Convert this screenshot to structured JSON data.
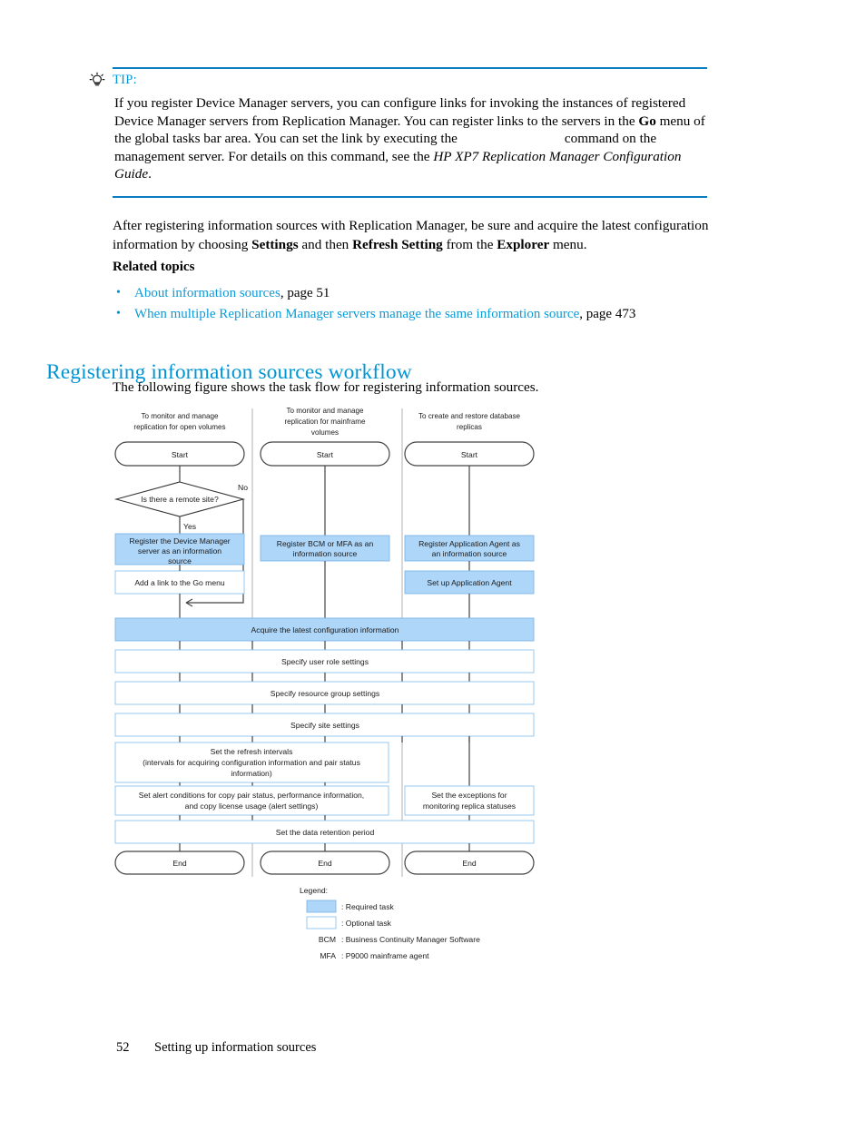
{
  "tip": {
    "icon": "lightbulb-icon",
    "label": "TIP:",
    "body_part1": "If you register Device Manager servers, you can configure links for invoking the instances of registered Device Manager servers from Replication Manager. You can register links to the servers in the ",
    "body_bold1": "Go",
    "body_part2": " menu of the global tasks bar area. You can set the link by executing the",
    "body_part3": "command on the management server. For details on this command, see the ",
    "body_italic1": "HP XP7 Replication Manager Configuration Guide",
    "body_part4": "."
  },
  "after_paragraph": {
    "part1": "After registering information sources with Replication Manager, be sure and acquire the latest configuration information by choosing ",
    "bold1": "Settings",
    "part2": " and then ",
    "bold2": "Refresh Setting",
    "part3": " from the ",
    "bold3": "Explorer",
    "part4": " menu."
  },
  "related": {
    "heading": "Related topics",
    "items": [
      {
        "link": "About information sources",
        "page": ", page 51"
      },
      {
        "link": "When multiple Replication Manager servers manage the same information source",
        "page": ", page 473"
      }
    ]
  },
  "section": {
    "heading": "Registering information sources workflow",
    "intro": "The following figure shows the task flow for registering information sources."
  },
  "figure": {
    "columns": [
      {
        "title_line1": "To monitor and manage",
        "title_line2": "replication for open volumes",
        "title_line3": ""
      },
      {
        "title_line1": "To monitor and manage",
        "title_line2": "replication for mainframe",
        "title_line3": "volumes"
      },
      {
        "title_line1": "To create and restore database",
        "title_line2": "replicas",
        "title_line3": ""
      }
    ],
    "terminators": {
      "start": "Start",
      "end": "End"
    },
    "decision": {
      "text": "Is there a remote site?",
      "yes_label": "Yes",
      "no_label": "No"
    },
    "col1_boxes": [
      {
        "type": "required",
        "line1": "Register the Device Manager",
        "line2": "server as an information",
        "line3": "source"
      },
      {
        "type": "optional",
        "line1": "Add a link to the Go menu",
        "line2": "",
        "line3": ""
      }
    ],
    "col2_boxes": [
      {
        "type": "required",
        "line1": "Register BCM or MFA as an",
        "line2": "information source",
        "line3": ""
      }
    ],
    "col3_boxes": [
      {
        "type": "required",
        "line1": "Register Application Agent as",
        "line2": "an information source",
        "line3": ""
      },
      {
        "type": "required",
        "line1": "Set up Application Agent",
        "line2": "",
        "line3": ""
      }
    ],
    "full_width_boxes": [
      {
        "type": "required",
        "line1": "Acquire the latest configuration information",
        "line2": "",
        "line3": ""
      },
      {
        "type": "optional",
        "line1": "Specify user role settings",
        "line2": "",
        "line3": ""
      },
      {
        "type": "optional",
        "line1": "Specify resource group settings",
        "line2": "",
        "line3": ""
      },
      {
        "type": "optional",
        "line1": "Specify site settings",
        "line2": "",
        "line3": ""
      }
    ],
    "refresh_box": {
      "type": "optional",
      "line1": "Set the refresh intervals",
      "line2": "(intervals for acquiring configuration information and pair status",
      "line3": "information)"
    },
    "alert_box": {
      "type": "optional",
      "line1": "Set alert conditions for copy pair status, performance information,",
      "line2": "and copy license usage (alert settings)",
      "line3": ""
    },
    "exceptions_box": {
      "type": "optional",
      "line1": "Set the exceptions for",
      "line2": "monitoring replica statuses",
      "line3": ""
    },
    "retention_box": {
      "type": "optional",
      "line1": "Set the data retention period",
      "line2": "",
      "line3": ""
    },
    "legend": {
      "title": "Legend:",
      "required_label": ": Required task",
      "optional_label": ": Optional task",
      "bcm_key": "BCM",
      "bcm_value": ": Business Continuity Manager Software",
      "mfa_key": "MFA",
      "mfa_value": ": P9000 mainframe agent"
    }
  },
  "footer": {
    "page_number": "52",
    "title": "Setting up information sources"
  },
  "colors": {
    "accent_blue": "#0096d6",
    "link_blue": "#0c9bd8",
    "required_fill": "#aed6f8",
    "optional_stroke": "#8fc4ee",
    "rule_blue": "#0a7dc0"
  }
}
